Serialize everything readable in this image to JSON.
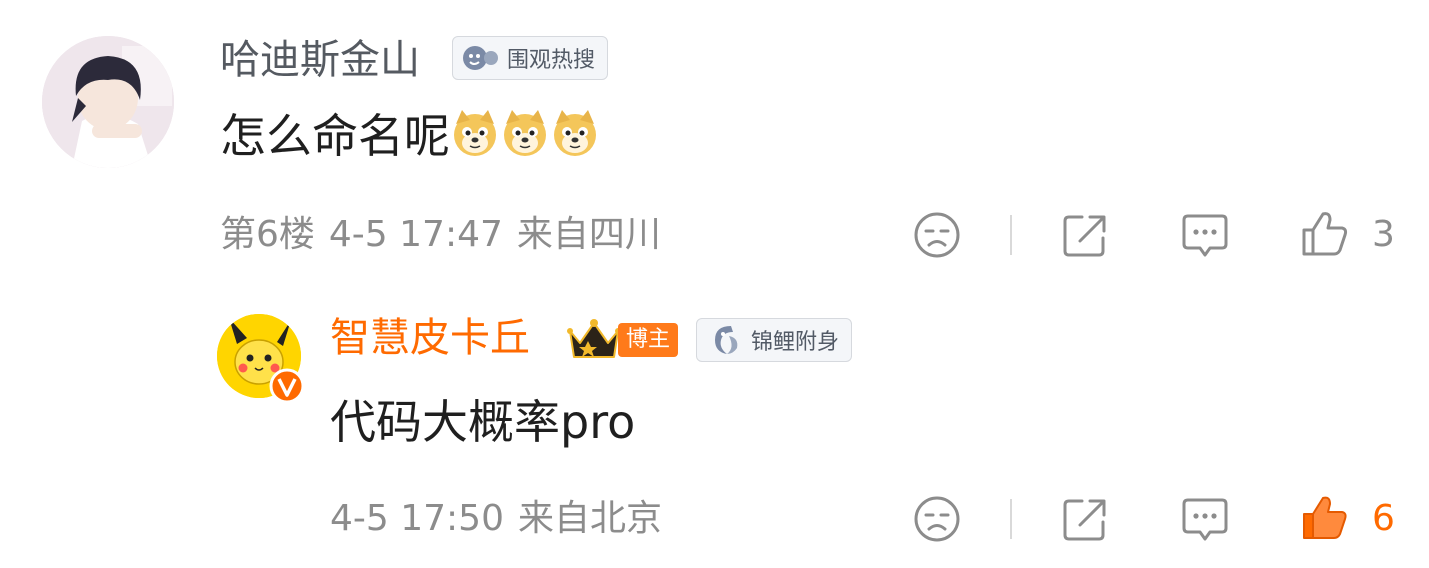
{
  "comment1": {
    "username": "哈迪斯金山",
    "badge": "围观热搜",
    "text": "怎么命名呢",
    "emoji": [
      "doge-emoji",
      "doge-emoji",
      "doge-emoji"
    ],
    "floor": "第6楼",
    "time": "4-5 17:47",
    "location": "来自四川",
    "like_count": "3"
  },
  "reply": {
    "username": "智慧皮卡丘",
    "role_tag": "博主",
    "badge": "锦鲤附身",
    "text": "代码大概率pro",
    "time": "4-5 17:50",
    "location": "来自北京",
    "like_count": "6"
  },
  "colors": {
    "username_default": "#555a61",
    "username_blogger": "#ff6a00",
    "meta": "#8c8c8c",
    "liked": "#ff6a00"
  },
  "icons": [
    "dislike-icon",
    "share-icon",
    "comment-icon",
    "like-icon",
    "verified-icon",
    "crown-icon",
    "koi-icon",
    "spectator-icon"
  ]
}
